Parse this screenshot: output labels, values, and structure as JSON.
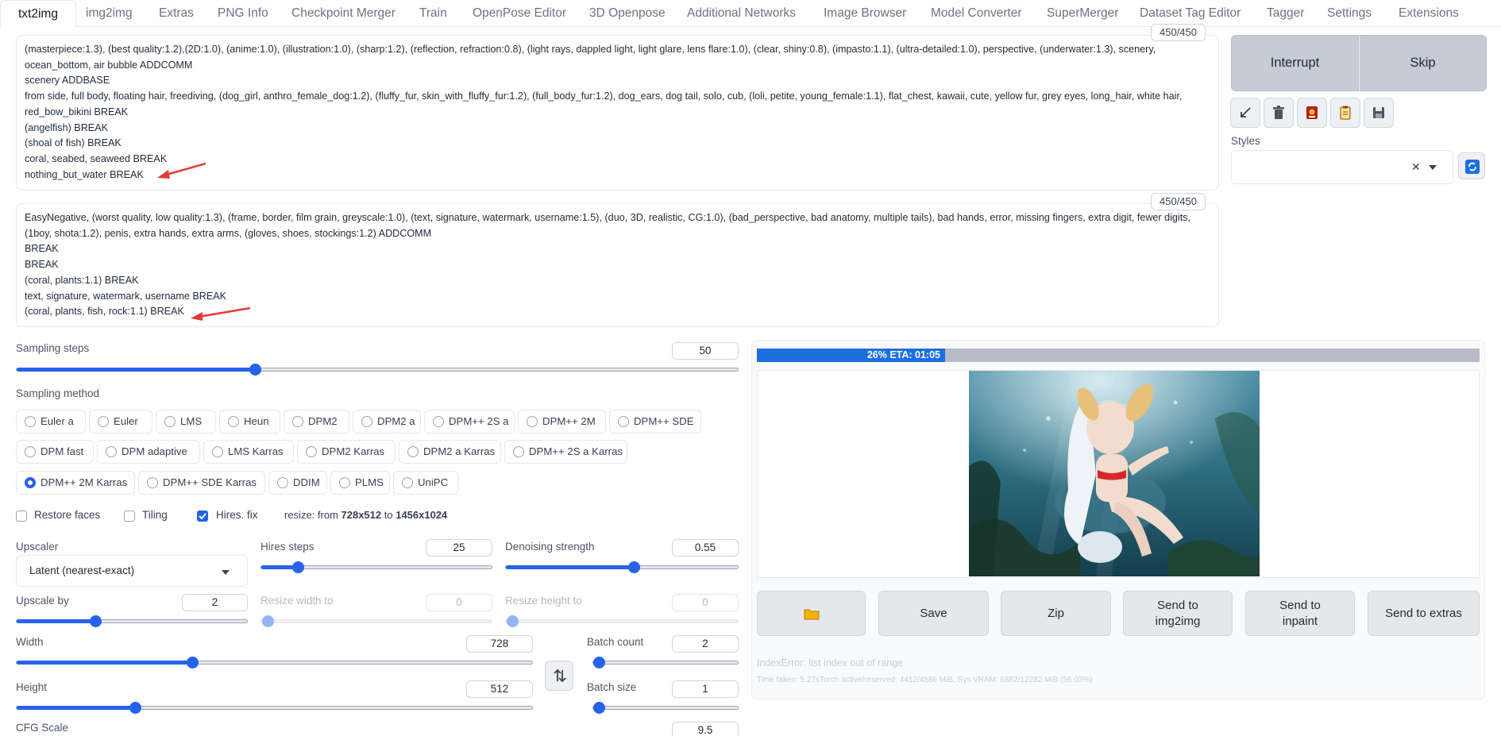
{
  "tabs": [
    "txt2img",
    "img2img",
    "Extras",
    "PNG Info",
    "Checkpoint Merger",
    "Train",
    "OpenPose Editor",
    "3D Openpose",
    "Additional Networks",
    "Image Browser",
    "Model Converter",
    "SuperMerger",
    "Dataset Tag Editor",
    "Tagger",
    "Settings",
    "Extensions"
  ],
  "positive_prompt": {
    "token_count": "450/450",
    "lines": [
      "(masterpiece:1.3), (best quality:1.2),(2D:1.0), (anime:1.0), (illustration:1.0), (sharp:1.2), (reflection, refraction:0.8), (light rays, dappled light, light glare, lens flare:1.0), (clear, shiny:0.8), (impasto:1.1), (ultra-detailed:1.0), perspective, (underwater:1.3), scenery, ocean_bottom, air bubble ADDCOMM",
      "scenery ADDBASE",
      "from side, full body, floating hair, freediving, (dog_girl, anthro_female_dog:1.2), (fluffy_fur, skin_with_fluffy_fur:1.2), (full_body_fur:1.2), dog_ears, dog tail, solo, cub, (loli, petite, young_female:1.1), flat_chest, kawaii, cute, yellow fur, grey eyes, long_hair, white hair, red_bow_bikini BREAK",
      "(angelfish) BREAK",
      "(shoal of fish) BREAK",
      "coral, seabed, seaweed BREAK",
      "nothing_but_water BREAK"
    ]
  },
  "negative_prompt": {
    "token_count": "450/450",
    "lines": [
      "EasyNegative, (worst quality, low quality:1.3), (frame, border, film grain, greyscale:1.0), (text, signature, watermark, username:1.5), (duo, 3D, realistic, CG:1.0), (bad_perspective, bad anatomy, multiple tails), bad hands, error, missing fingers, extra digit, fewer digits, (1boy, shota:1.2), penis, extra hands, extra arms, (gloves, shoes, stockings:1.2) ADDCOMM",
      "BREAK",
      "BREAK",
      "(coral, plants:1.1) BREAK",
      "text, signature, watermark, username BREAK",
      "(coral, plants, fish, rock:1.1) BREAK"
    ]
  },
  "controls": {
    "interrupt": "Interrupt",
    "skip": "Skip",
    "styles_label": "Styles",
    "tool_icons": [
      "arrow-icon",
      "trash-icon",
      "card-icon",
      "clipboard-icon",
      "save-icon"
    ]
  },
  "sampling_steps": {
    "label": "Sampling steps",
    "value": "50",
    "fraction": 0.33
  },
  "sampling_method": {
    "label": "Sampling method",
    "selected": "DPM++ 2M Karras",
    "rows": [
      [
        "Euler a",
        "Euler",
        "LMS",
        "Heun",
        "DPM2",
        "DPM2 a",
        "DPM++ 2S a",
        "DPM++ 2M",
        "DPM++ SDE"
      ],
      [
        "DPM fast",
        "DPM adaptive",
        "LMS Karras",
        "DPM2 Karras",
        "DPM2 a Karras",
        "DPM++ 2S a Karras"
      ],
      [
        "DPM++ 2M Karras",
        "DPM++ SDE Karras",
        "DDIM",
        "PLMS",
        "UniPC"
      ]
    ]
  },
  "options": {
    "restore_faces": {
      "label": "Restore faces",
      "checked": false
    },
    "tiling": {
      "label": "Tiling",
      "checked": false
    },
    "hires_fix": {
      "label": "Hires. fix",
      "checked": true
    },
    "resize_prefix": "resize: from ",
    "resize_from": "728x512",
    "resize_to_word": " to ",
    "resize_to": "1456x1024"
  },
  "hires": {
    "upscaler_label": "Upscaler",
    "upscaler_value": "Latent (nearest-exact)",
    "hires_steps_label": "Hires steps",
    "hires_steps_value": "25",
    "hires_steps_fraction": 0.16,
    "denoising_label": "Denoising strength",
    "denoising_value": "0.55",
    "denoising_fraction": 0.55,
    "upscale_by_label": "Upscale by",
    "upscale_by_value": "2",
    "upscale_by_fraction": 0.34,
    "resize_width_label": "Resize width to",
    "resize_width_value": "0",
    "resize_height_label": "Resize height to",
    "resize_height_value": "0"
  },
  "size": {
    "width_label": "Width",
    "width_value": "728",
    "width_fraction": 0.34,
    "height_label": "Height",
    "height_value": "512",
    "height_fraction": 0.23,
    "batch_count_label": "Batch count",
    "batch_count_value": "2",
    "batch_count_fraction": 0.0,
    "batch_size_label": "Batch size",
    "batch_size_value": "1",
    "batch_size_fraction": 0.0
  },
  "cfg": {
    "label": "CFG Scale",
    "value": "9.5"
  },
  "output": {
    "progress_fraction": 0.26,
    "progress_text": "26% ETA: 01:05",
    "buttons": [
      "Save",
      "Zip",
      "Send to img2img",
      "Send to inpaint",
      "Send to extras"
    ],
    "folder_icon": "folder-icon",
    "error": "IndexError: list index out of range",
    "time_info": "Time taken: 5.27sTorch active/reserved: 4412/4586 MiB, Sys VRAM: 6882/12282 MiB (56.03%)"
  },
  "colors": {
    "accent": "#2563eb",
    "progress": "#1d6fe0",
    "annotation_arrow": "#e53935"
  }
}
